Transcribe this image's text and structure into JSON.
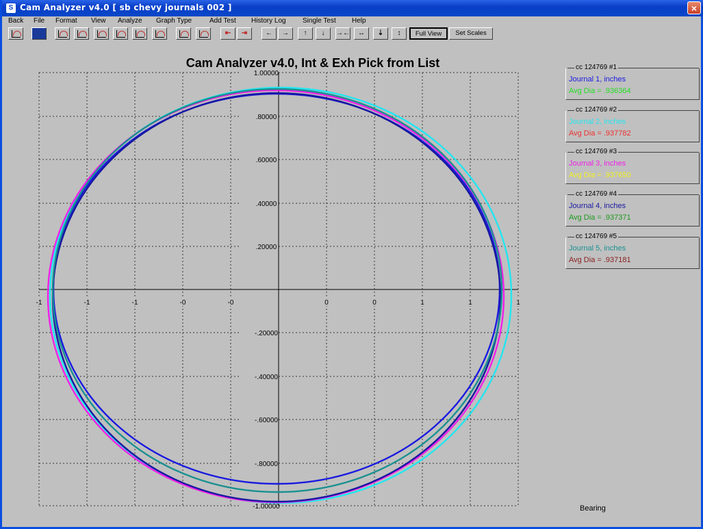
{
  "window": {
    "title": "Cam Analyzer v4.0  [ sb chevy journals 002 ]",
    "close_glyph": "×"
  },
  "menu": [
    "Back",
    "File",
    "Format",
    "View",
    "Analyze",
    "Graph Type",
    "Add Test",
    "History Log",
    "Single Test",
    "Help"
  ],
  "toolbar": {
    "full_view": "Full View",
    "set_scales": "Set Scales"
  },
  "chart_data": {
    "type": "polar-overlay",
    "title": "Cam Analyzer v4.0,   Int & Exh Pick from List",
    "y_ticks": [
      "1.00000",
      ".80000",
      ".60000",
      ".40000",
      ".20000",
      "-.20000",
      "-.40000",
      "-.60000",
      "-.80000",
      "-1.00000"
    ],
    "x_ticks": [
      "-1",
      "-1",
      "-1",
      "-0",
      "-0",
      "0",
      "0",
      "1",
      "1",
      "1"
    ],
    "grid": true,
    "series": [
      {
        "name": "Journal 1, inches",
        "color": "#1a1ae0",
        "avg": "Avg Dia = .936364",
        "avg_color": "#22dd22"
      },
      {
        "name": "Journal 2, inches",
        "color": "#22e6f0",
        "avg": "Avg Dia = .937782",
        "avg_color": "#ee3030"
      },
      {
        "name": "Journal 3, inches",
        "color": "#f020e8",
        "avg": "Avg Dia = .937650",
        "avg_color": "#f0f020"
      },
      {
        "name": "Journal 4, inches",
        "color": "#1818a0",
        "avg": "Avg Dia = .937371",
        "avg_color": "#1a9a1a"
      },
      {
        "name": "Journal 5, inches",
        "color": "#1a9090",
        "avg": "Avg Dia = .937181",
        "avg_color": "#8a2020"
      }
    ]
  },
  "legend": [
    {
      "title": "cc 124769 #1"
    },
    {
      "title": "cc 124769 #2"
    },
    {
      "title": "cc 124769 #3"
    },
    {
      "title": "cc 124769 #4"
    },
    {
      "title": "cc 124769 #5"
    }
  ],
  "footer_label": "Bearing"
}
